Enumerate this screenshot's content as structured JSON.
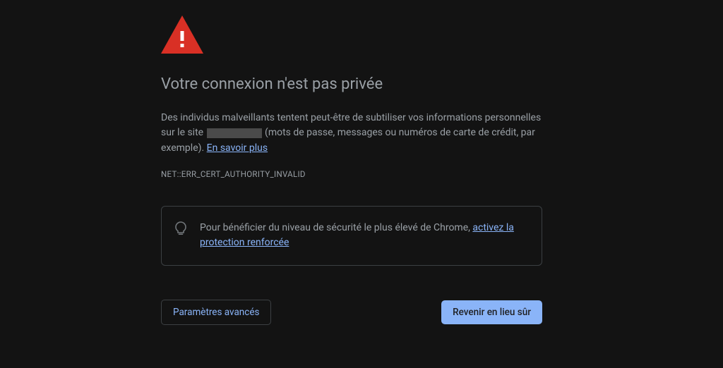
{
  "icon": {
    "warning_color": "#d93025",
    "bulb_color": "#9aa0a6"
  },
  "heading": "Votre connexion n'est pas privée",
  "description": {
    "part1": "Des individus malveillants tentent peut-être de subtiliser vos informations personnelles sur le site ",
    "part2": " (mots de passe, messages ou numéros de carte de crédit, par exemple). ",
    "learn_more": "En savoir plus"
  },
  "error_code": "NET::ERR_CERT_AUTHORITY_INVALID",
  "info_box": {
    "text_before_link": "Pour bénéficier du niveau de sécurité le plus élevé de Chrome, ",
    "link_text": "activez la protection renforcée"
  },
  "buttons": {
    "advanced": "Paramètres avancés",
    "back_to_safety": "Revenir en lieu sûr"
  }
}
